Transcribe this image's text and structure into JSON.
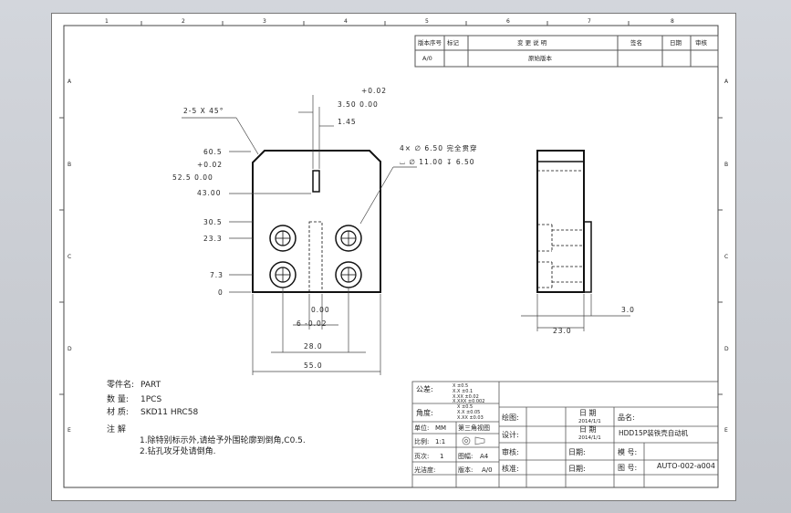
{
  "border": {
    "top_zones": [
      "1",
      "2",
      "3",
      "4",
      "5",
      "6",
      "7",
      "8"
    ],
    "side_zones": [
      "A",
      "B",
      "C",
      "D",
      "E"
    ]
  },
  "revision": {
    "headers": [
      "版本序号",
      "标记",
      "变 更 说 明",
      "签名",
      "日期",
      "审核"
    ],
    "row": [
      "A/0",
      "",
      "原始版本",
      "",
      "",
      ""
    ]
  },
  "front_view": {
    "chamfer": "2-5 X 45°",
    "tol_top": "+0.02",
    "slot_x": "3.50  0.00",
    "slot_w": "1.45",
    "hole_note_1": "4× ∅ 6.50 完全贯穿",
    "hole_note_2": "⌴ ∅ 11.00 ↧ 6.50",
    "y_labels": [
      "60.5",
      "+0.02",
      "52.5  0.00",
      "43.00",
      "30.5",
      "23.3",
      "7.3",
      "0"
    ],
    "x_labels": [
      "0.00",
      "6 -0.02",
      "28.0",
      "55.0"
    ]
  },
  "side_view": {
    "dims": [
      "3.0",
      "23.0"
    ]
  },
  "notes": {
    "part_name_label": "零件名:",
    "part_name": "PART",
    "qty_label": "数 量:",
    "qty": "1PCS",
    "material_label": "材 质:",
    "material": "SKD11  HRC58",
    "notes_title": "注  解",
    "note_1": "1.除特别标示外,请给予外围轮廓到倒角,C0.5.",
    "note_2": "2.钻孔攻牙处请倒角."
  },
  "title_block": {
    "tolerance_label": "公差:",
    "tol_lines": [
      "X  ±0.5",
      "X.X  ±0.1",
      "X.XX  ±0.02",
      "X.XXX  ±0.002"
    ],
    "angle_label": "角度:",
    "angle_lines": [
      "X  ±0.5",
      "X.X  ±0.05",
      "X.XX  ±0.03"
    ],
    "unit_label": "单位:",
    "unit": "MM",
    "proj_label": "第三角视图",
    "scale_label": "比例:",
    "scale": "1:1",
    "pages_label": "页次:",
    "pages": "1",
    "sheet_label": "图幅:",
    "sheet": "A4",
    "finish_label": "光洁度:",
    "rev_label": "版本:",
    "rev": "A/0",
    "draw_label": "绘图:",
    "design_label": "设计:",
    "check_label": "审核:",
    "approve_label": "核准:",
    "date_label": "日 期",
    "date_1": "2014/1/1",
    "date_2": "2014/1/1",
    "date_short": "日期:",
    "product_label": "品名:",
    "product": "HDD15P装铁壳自动机",
    "model_label": "模 号:",
    "drawing_no_label": "图 号:",
    "drawing_no": "AUTO-002-a004"
  }
}
